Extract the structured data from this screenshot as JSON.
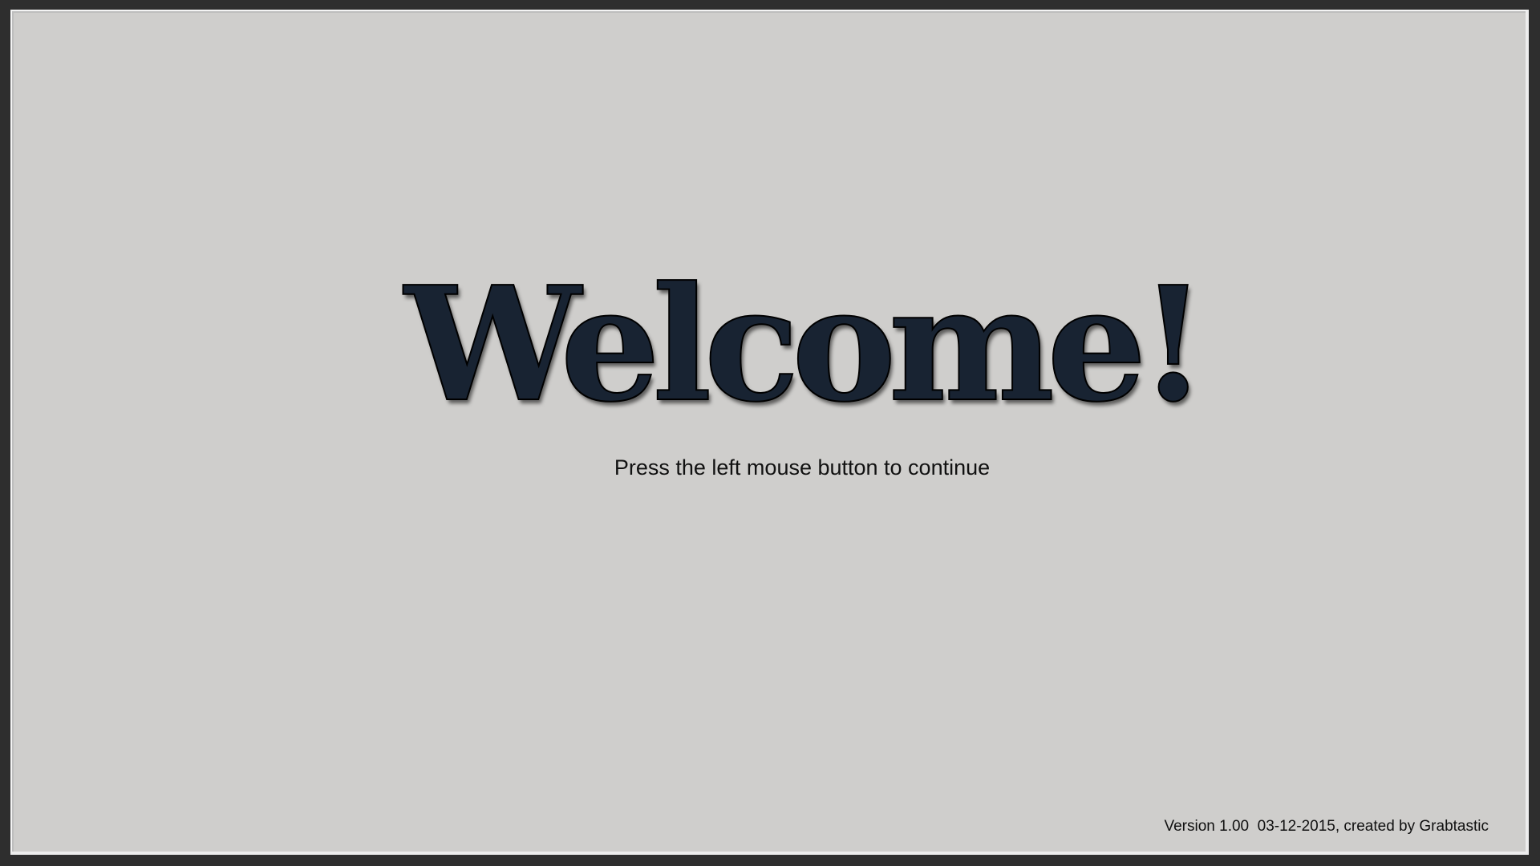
{
  "splash": {
    "title": "Welcome!",
    "instruction": "Press the left mouse button to continue",
    "version_info": "Version 1.00  03-12-2015, created by Grabtastic"
  },
  "colors": {
    "background": "#cfcecc",
    "title": "#182332",
    "frame": "#2e2e2e"
  }
}
